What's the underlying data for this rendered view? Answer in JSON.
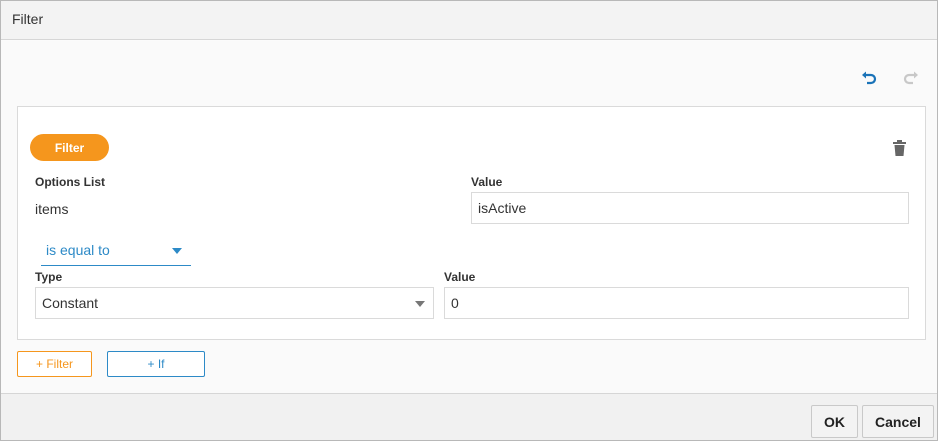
{
  "dialog": {
    "title": "Filter"
  },
  "toolbar": {
    "undo_icon": "undo-icon",
    "redo_icon": "redo-icon",
    "undo_color": "#1a73b8",
    "redo_color": "#c8c8c8"
  },
  "filter_block": {
    "pill_label": "Filter",
    "pill_color": "#f5961d",
    "delete_icon": "trash-icon",
    "options_list_label": "Options List",
    "options_list_value": "items",
    "value_label": "Value",
    "value_field": "isActive",
    "operator": "is equal to",
    "type_label": "Type",
    "type_value": "Constant",
    "compare_value_label": "Value",
    "compare_value": "0"
  },
  "actions": {
    "add_filter_label": "+ Filter",
    "add_if_label": "+ If"
  },
  "footer": {
    "ok_label": "OK",
    "cancel_label": "Cancel"
  }
}
